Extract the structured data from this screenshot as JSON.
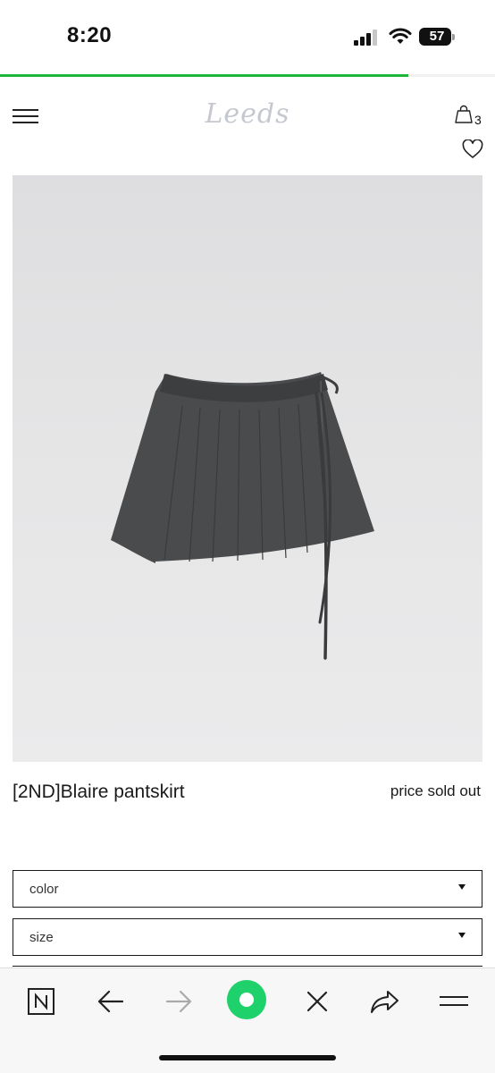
{
  "status_bar": {
    "time": "8:20",
    "battery_level": "57",
    "icons": [
      "signal-icon",
      "wifi-icon",
      "battery-icon"
    ]
  },
  "page_load_progress": 0.825,
  "header": {
    "logo": "Leeds",
    "cart_count": "3",
    "icons": [
      "menu-icon",
      "shopping-bag-icon",
      "heart-icon"
    ]
  },
  "product": {
    "image_alt": "",
    "name": "[2ND]Blaire pantskirt",
    "price": "price sold out"
  },
  "options": {
    "color_label": "color",
    "size_label": "size"
  },
  "toolbar": {
    "icons": [
      "home-n-icon",
      "back-arrow-icon",
      "forward-arrow-icon",
      "green-assistant-icon",
      "close-icon",
      "share-icon",
      "hamburger-menu-icon"
    ]
  },
  "colors": {
    "accent_green": "#1fb53b",
    "assistant_green": "#1fd16b",
    "logo_grey": "#c5c8d0",
    "product_bg": "#e3e3e4",
    "skirt": "#4a4b4d"
  }
}
